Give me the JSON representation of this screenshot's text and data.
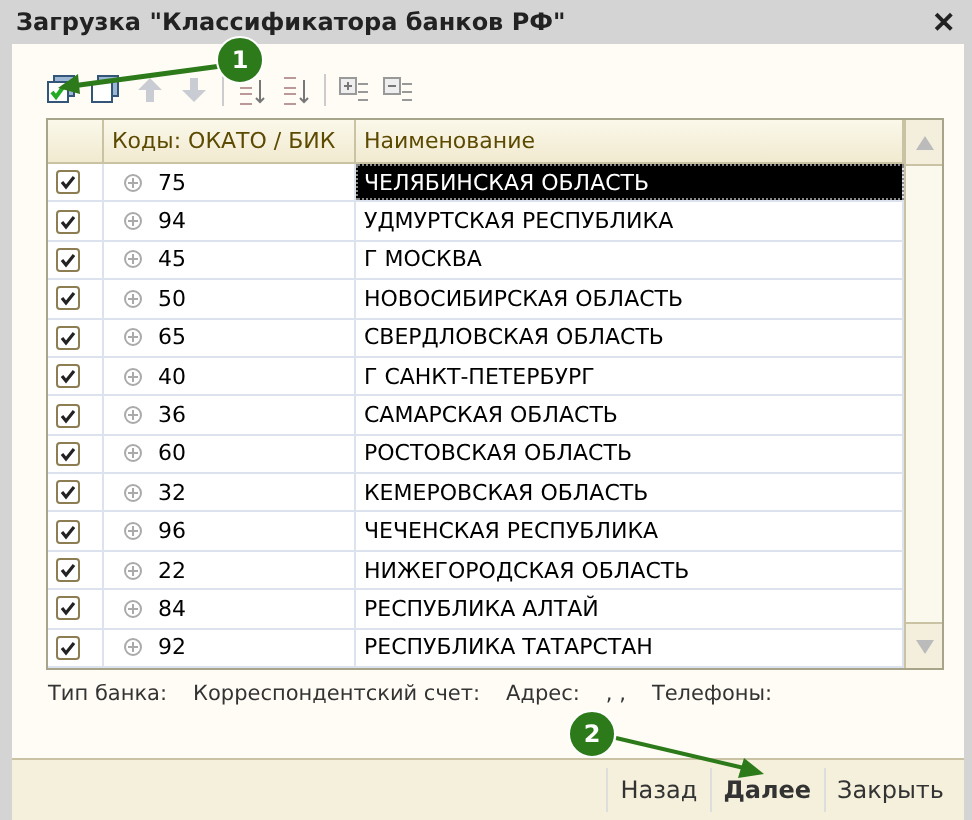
{
  "window": {
    "title": "Загрузка \"Классификатора банков РФ\"",
    "close": "✕"
  },
  "table": {
    "columns": [
      "Коды: ОКАТО / БИК",
      "Наименование"
    ],
    "rows": [
      {
        "checked": true,
        "code": "75",
        "name": "ЧЕЛЯБИНСКАЯ ОБЛАСТЬ",
        "selected": true
      },
      {
        "checked": true,
        "code": "94",
        "name": "УДМУРТСКАЯ РЕСПУБЛИКА",
        "selected": false
      },
      {
        "checked": true,
        "code": "45",
        "name": "Г МОСКВА",
        "selected": false
      },
      {
        "checked": true,
        "code": "50",
        "name": "НОВОСИБИРСКАЯ ОБЛАСТЬ",
        "selected": false
      },
      {
        "checked": true,
        "code": "65",
        "name": "СВЕРДЛОВСКАЯ ОБЛАСТЬ",
        "selected": false
      },
      {
        "checked": true,
        "code": "40",
        "name": "Г САНКТ-ПЕТЕРБУРГ",
        "selected": false
      },
      {
        "checked": true,
        "code": "36",
        "name": "САМАРСКАЯ ОБЛАСТЬ",
        "selected": false
      },
      {
        "checked": true,
        "code": "60",
        "name": "РОСТОВСКАЯ ОБЛАСТЬ",
        "selected": false
      },
      {
        "checked": true,
        "code": "32",
        "name": "КЕМЕРОВСКАЯ ОБЛАСТЬ",
        "selected": false
      },
      {
        "checked": true,
        "code": "96",
        "name": "ЧЕЧЕНСКАЯ РЕСПУБЛИКА",
        "selected": false
      },
      {
        "checked": true,
        "code": "22",
        "name": "НИЖЕГОРОДСКАЯ ОБЛАСТЬ",
        "selected": false
      },
      {
        "checked": true,
        "code": "84",
        "name": "РЕСПУБЛИКА АЛТАЙ",
        "selected": false
      },
      {
        "checked": true,
        "code": "92",
        "name": "РЕСПУБЛИКА ТАТАРСТАН",
        "selected": false
      }
    ]
  },
  "details": [
    "Тип банка:",
    "Корреспондентский счет:",
    "Адрес:",
    ", ,",
    "Телефоны:"
  ],
  "buttons": [
    {
      "label": "Назад",
      "default": false
    },
    {
      "label": "Далее",
      "default": true
    },
    {
      "label": "Закрыть",
      "default": false
    }
  ],
  "callouts": [
    "1",
    "2"
  ]
}
